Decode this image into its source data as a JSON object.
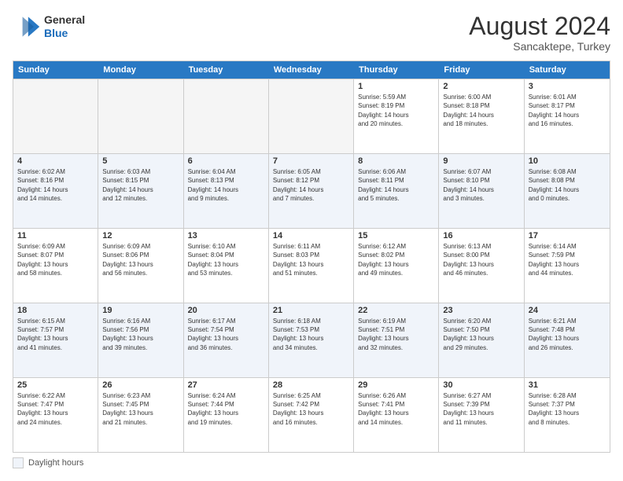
{
  "header": {
    "logo": {
      "line1": "General",
      "line2": "Blue"
    },
    "title": "August 2024",
    "subtitle": "Sancaktepe, Turkey"
  },
  "days": [
    "Sunday",
    "Monday",
    "Tuesday",
    "Wednesday",
    "Thursday",
    "Friday",
    "Saturday"
  ],
  "footer": {
    "daylight_label": "Daylight hours"
  },
  "rows": [
    {
      "alt": false,
      "cells": [
        {
          "date": "",
          "info": "",
          "empty": true
        },
        {
          "date": "",
          "info": "",
          "empty": true
        },
        {
          "date": "",
          "info": "",
          "empty": true
        },
        {
          "date": "",
          "info": "",
          "empty": true
        },
        {
          "date": "1",
          "info": "Sunrise: 5:59 AM\nSunset: 8:19 PM\nDaylight: 14 hours\nand 20 minutes."
        },
        {
          "date": "2",
          "info": "Sunrise: 6:00 AM\nSunset: 8:18 PM\nDaylight: 14 hours\nand 18 minutes."
        },
        {
          "date": "3",
          "info": "Sunrise: 6:01 AM\nSunset: 8:17 PM\nDaylight: 14 hours\nand 16 minutes."
        }
      ]
    },
    {
      "alt": true,
      "cells": [
        {
          "date": "4",
          "info": "Sunrise: 6:02 AM\nSunset: 8:16 PM\nDaylight: 14 hours\nand 14 minutes."
        },
        {
          "date": "5",
          "info": "Sunrise: 6:03 AM\nSunset: 8:15 PM\nDaylight: 14 hours\nand 12 minutes."
        },
        {
          "date": "6",
          "info": "Sunrise: 6:04 AM\nSunset: 8:13 PM\nDaylight: 14 hours\nand 9 minutes."
        },
        {
          "date": "7",
          "info": "Sunrise: 6:05 AM\nSunset: 8:12 PM\nDaylight: 14 hours\nand 7 minutes."
        },
        {
          "date": "8",
          "info": "Sunrise: 6:06 AM\nSunset: 8:11 PM\nDaylight: 14 hours\nand 5 minutes."
        },
        {
          "date": "9",
          "info": "Sunrise: 6:07 AM\nSunset: 8:10 PM\nDaylight: 14 hours\nand 3 minutes."
        },
        {
          "date": "10",
          "info": "Sunrise: 6:08 AM\nSunset: 8:08 PM\nDaylight: 14 hours\nand 0 minutes."
        }
      ]
    },
    {
      "alt": false,
      "cells": [
        {
          "date": "11",
          "info": "Sunrise: 6:09 AM\nSunset: 8:07 PM\nDaylight: 13 hours\nand 58 minutes."
        },
        {
          "date": "12",
          "info": "Sunrise: 6:09 AM\nSunset: 8:06 PM\nDaylight: 13 hours\nand 56 minutes."
        },
        {
          "date": "13",
          "info": "Sunrise: 6:10 AM\nSunset: 8:04 PM\nDaylight: 13 hours\nand 53 minutes."
        },
        {
          "date": "14",
          "info": "Sunrise: 6:11 AM\nSunset: 8:03 PM\nDaylight: 13 hours\nand 51 minutes."
        },
        {
          "date": "15",
          "info": "Sunrise: 6:12 AM\nSunset: 8:02 PM\nDaylight: 13 hours\nand 49 minutes."
        },
        {
          "date": "16",
          "info": "Sunrise: 6:13 AM\nSunset: 8:00 PM\nDaylight: 13 hours\nand 46 minutes."
        },
        {
          "date": "17",
          "info": "Sunrise: 6:14 AM\nSunset: 7:59 PM\nDaylight: 13 hours\nand 44 minutes."
        }
      ]
    },
    {
      "alt": true,
      "cells": [
        {
          "date": "18",
          "info": "Sunrise: 6:15 AM\nSunset: 7:57 PM\nDaylight: 13 hours\nand 41 minutes."
        },
        {
          "date": "19",
          "info": "Sunrise: 6:16 AM\nSunset: 7:56 PM\nDaylight: 13 hours\nand 39 minutes."
        },
        {
          "date": "20",
          "info": "Sunrise: 6:17 AM\nSunset: 7:54 PM\nDaylight: 13 hours\nand 36 minutes."
        },
        {
          "date": "21",
          "info": "Sunrise: 6:18 AM\nSunset: 7:53 PM\nDaylight: 13 hours\nand 34 minutes."
        },
        {
          "date": "22",
          "info": "Sunrise: 6:19 AM\nSunset: 7:51 PM\nDaylight: 13 hours\nand 32 minutes."
        },
        {
          "date": "23",
          "info": "Sunrise: 6:20 AM\nSunset: 7:50 PM\nDaylight: 13 hours\nand 29 minutes."
        },
        {
          "date": "24",
          "info": "Sunrise: 6:21 AM\nSunset: 7:48 PM\nDaylight: 13 hours\nand 26 minutes."
        }
      ]
    },
    {
      "alt": false,
      "cells": [
        {
          "date": "25",
          "info": "Sunrise: 6:22 AM\nSunset: 7:47 PM\nDaylight: 13 hours\nand 24 minutes."
        },
        {
          "date": "26",
          "info": "Sunrise: 6:23 AM\nSunset: 7:45 PM\nDaylight: 13 hours\nand 21 minutes."
        },
        {
          "date": "27",
          "info": "Sunrise: 6:24 AM\nSunset: 7:44 PM\nDaylight: 13 hours\nand 19 minutes."
        },
        {
          "date": "28",
          "info": "Sunrise: 6:25 AM\nSunset: 7:42 PM\nDaylight: 13 hours\nand 16 minutes."
        },
        {
          "date": "29",
          "info": "Sunrise: 6:26 AM\nSunset: 7:41 PM\nDaylight: 13 hours\nand 14 minutes."
        },
        {
          "date": "30",
          "info": "Sunrise: 6:27 AM\nSunset: 7:39 PM\nDaylight: 13 hours\nand 11 minutes."
        },
        {
          "date": "31",
          "info": "Sunrise: 6:28 AM\nSunset: 7:37 PM\nDaylight: 13 hours\nand 8 minutes."
        }
      ]
    }
  ]
}
